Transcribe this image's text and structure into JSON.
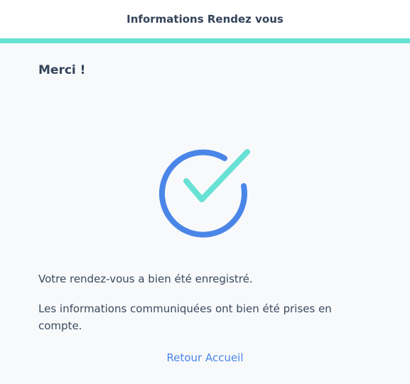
{
  "header": {
    "title": "Informations Rendez vous"
  },
  "main": {
    "title": "Merci !",
    "success_icon": "check-circle-icon",
    "messages": [
      "Votre rendez-vous a bien été enregistré.",
      "Les informations communiquées ont bien été prises en compte."
    ],
    "back_link_label": "Retour Accueil"
  },
  "colors": {
    "accent": "#67e1d3",
    "circle": "#4a86e8",
    "check": "#67e1d3",
    "link": "#4a86e8"
  }
}
